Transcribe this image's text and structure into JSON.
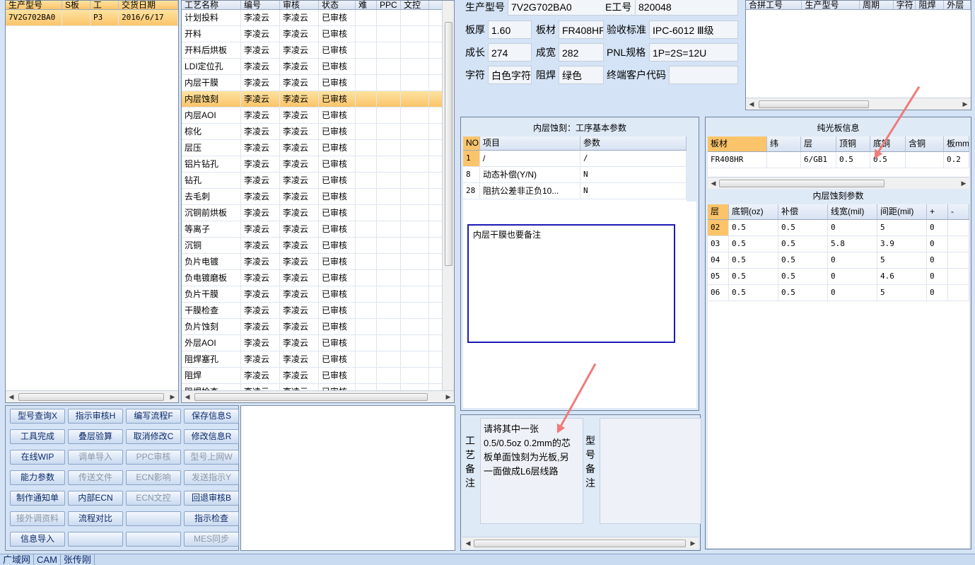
{
  "models": {
    "headers": [
      "生产型号",
      "S板",
      "工",
      "交货日期"
    ],
    "rows": [
      [
        "7V2G702BA0",
        "",
        "P3",
        "2016/6/17"
      ]
    ]
  },
  "process": {
    "headers": [
      "工艺名称",
      "编号",
      "审核",
      "状态",
      "难",
      "PPC",
      "文控"
    ],
    "rows": [
      [
        "计划投料",
        "李凌云",
        "李凌云",
        "已审核"
      ],
      [
        "开料",
        "李凌云",
        "李凌云",
        "已审核"
      ],
      [
        "开料后烘板",
        "李凌云",
        "李凌云",
        "已审核"
      ],
      [
        "LDI定位孔",
        "李凌云",
        "李凌云",
        "已审核"
      ],
      [
        "内层干膜",
        "李凌云",
        "李凌云",
        "已审核"
      ],
      [
        "内层蚀刻",
        "李凌云",
        "李凌云",
        "已审核"
      ],
      [
        "内层AOI",
        "李凌云",
        "李凌云",
        "已审核"
      ],
      [
        "棕化",
        "李凌云",
        "李凌云",
        "已审核"
      ],
      [
        "层压",
        "李凌云",
        "李凌云",
        "已审核"
      ],
      [
        "铝片钻孔",
        "李凌云",
        "李凌云",
        "已审核"
      ],
      [
        "钻孔",
        "李凌云",
        "李凌云",
        "已审核"
      ],
      [
        "去毛刺",
        "李凌云",
        "李凌云",
        "已审核"
      ],
      [
        "沉铜前烘板",
        "李凌云",
        "李凌云",
        "已审核"
      ],
      [
        "等离子",
        "李凌云",
        "李凌云",
        "已审核"
      ],
      [
        "沉铜",
        "李凌云",
        "李凌云",
        "已审核"
      ],
      [
        "负片电镀",
        "李凌云",
        "李凌云",
        "已审核"
      ],
      [
        "负电镀磨板",
        "李凌云",
        "李凌云",
        "已审核"
      ],
      [
        "负片干膜",
        "李凌云",
        "李凌云",
        "已审核"
      ],
      [
        "干膜检查",
        "李凌云",
        "李凌云",
        "已审核"
      ],
      [
        "负片蚀刻",
        "李凌云",
        "李凌云",
        "已审核"
      ],
      [
        "外层AOI",
        "李凌云",
        "李凌云",
        "已审核"
      ],
      [
        "阻焊塞孔",
        "李凌云",
        "李凌云",
        "已审核"
      ],
      [
        "阻焊",
        "李凌云",
        "李凌云",
        "已审核"
      ],
      [
        "阻焊检查",
        "李凌云",
        "李凌云",
        "已审核"
      ]
    ],
    "selected_index": 5
  },
  "buttons": [
    [
      "型号查询X",
      "指示审核H",
      "编写流程F",
      "保存信息S"
    ],
    [
      "工具完成",
      "叠层验算",
      "取消修改C",
      "修改信息R"
    ],
    [
      "在线WIP",
      "调单导入",
      "PPC审核",
      "型号上网W"
    ],
    [
      "能力参数",
      "传送文件",
      "ECN影响",
      "发送指示Y"
    ],
    [
      "制作通知单",
      "内部ECN",
      "ECN文控",
      "回退审核B"
    ],
    [
      "接外调资料",
      "流程对比",
      "",
      "指示检查"
    ],
    [
      "信息导入",
      "",
      "",
      "MES同步"
    ]
  ],
  "buttons_disabled": [
    "调单导入",
    "PPC审核",
    "型号上网W",
    "传送文件",
    "ECN影响",
    "发送指示Y",
    "ECN文控",
    "接外调资料",
    "MES同步"
  ],
  "info": {
    "model_label": "生产型号",
    "model_value": "7V2G702BA0",
    "eno_label": "E工号",
    "eno_value": "820048",
    "thick_label": "板厚",
    "thick_value": "1.60",
    "material_label": "板材",
    "material_value": "FR408HR",
    "std_label": "验收标准",
    "std_value": "IPC-6012 Ⅲ级",
    "len_label": "成长",
    "len_value": "274",
    "wid_label": "成宽",
    "wid_value": "282",
    "pnl_label": "PNL规格",
    "pnl_value": "1P=2S=12U",
    "char_label": "字符",
    "char_value": "白色字符",
    "mask_label": "阻焊",
    "mask_value": "绿色",
    "cust_label": "终端客户代码",
    "cust_value": ""
  },
  "merge": {
    "headers": [
      "合拼工号",
      "生产型号",
      "周期",
      "字符",
      "阻焊",
      "外层"
    ]
  },
  "step_params": {
    "title": "内层蚀刻：工序基本参数",
    "headers": [
      "NO",
      "项目",
      "参数"
    ],
    "rows": [
      [
        "1",
        "/",
        "/"
      ],
      [
        "8",
        "动态补偿(Y/N)",
        "N"
      ],
      [
        "28",
        "阻抗公差非正负10...",
        "N"
      ]
    ],
    "note": "内层干膜也要备注"
  },
  "remarks": {
    "process_label": "工艺备注",
    "process_text": "请将其中一张0.5/0.5oz 0.2mm的芯板单面蚀刻为光板,另一面做成L6层线路",
    "model_label": "型号备注",
    "model_text": ""
  },
  "bare_board": {
    "title": "纯光板信息",
    "headers": [
      "板材",
      "纬",
      "层",
      "顶铜",
      "底铜",
      "含铜",
      "板mm"
    ],
    "rows": [
      [
        "FR408HR",
        "",
        "6/GB1",
        "0.5",
        "0.5",
        "",
        "0.2"
      ]
    ]
  },
  "etch_params": {
    "title": "内层蚀刻参数",
    "headers": [
      "层",
      "底铜(oz)",
      "补偿",
      "线宽(mil)",
      "间距(mil)",
      "+",
      "-"
    ],
    "rows": [
      [
        "02",
        "0.5",
        "0.5",
        "0",
        "5",
        "0",
        ""
      ],
      [
        "03",
        "0.5",
        "0.5",
        "5.8",
        "3.9",
        "0",
        ""
      ],
      [
        "04",
        "0.5",
        "0.5",
        "0",
        "5",
        "0",
        ""
      ],
      [
        "05",
        "0.5",
        "0.5",
        "0",
        "4.6",
        "0",
        ""
      ],
      [
        "06",
        "0.5",
        "0.5",
        "0",
        "5",
        "0",
        ""
      ]
    ]
  },
  "statusbar": [
    "广域网",
    "CAM",
    "张传刚"
  ],
  "colors": {
    "accent_selected": "#fbc46a",
    "arrow": "#ef7b7b",
    "note_border": "#1a1ab4"
  }
}
